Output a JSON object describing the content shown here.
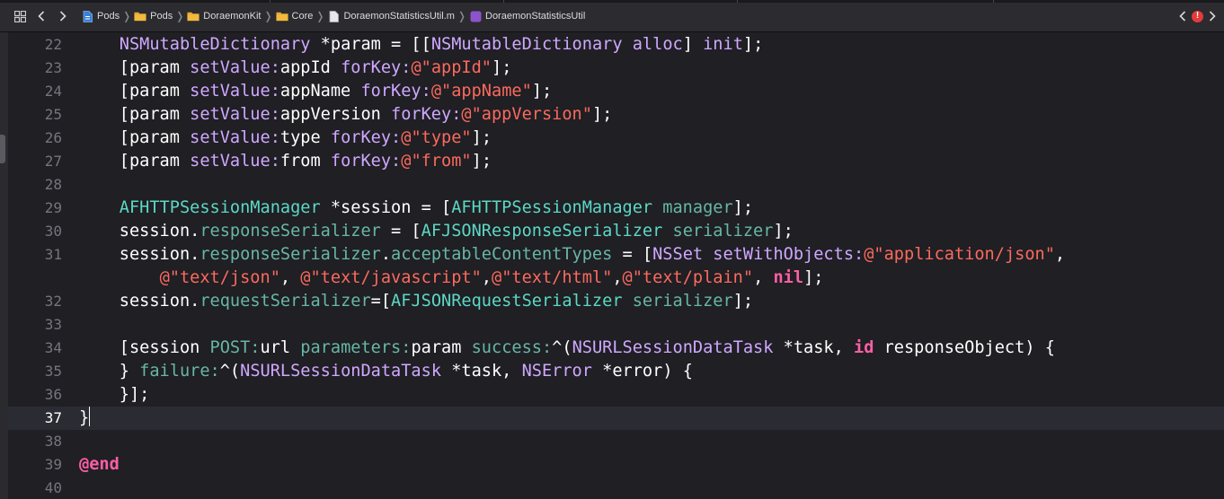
{
  "jumpbar": {
    "breadcrumbs": [
      {
        "label": "Pods",
        "icon": "project-file-icon"
      },
      {
        "label": "Pods",
        "icon": "folder-icon"
      },
      {
        "label": "DoraemonKit",
        "icon": "folder-icon"
      },
      {
        "label": "Core",
        "icon": "folder-icon"
      },
      {
        "label": "DoraemonStatisticsUtil.m",
        "icon": "objc-file-icon"
      },
      {
        "label": "DoraemonStatisticsUtil",
        "icon": "class-icon"
      }
    ],
    "class_icon_letter": "C",
    "file_icon_letter": "m",
    "issue_badge": "!",
    "back_glyph": "<",
    "forward_glyph": ">"
  },
  "editor": {
    "current_line": 37,
    "lines": [
      {
        "num": "22",
        "tokens": [
          {
            "t": "    "
          },
          {
            "t": "NSMutableDictionary",
            "c": "t-sys"
          },
          {
            "t": " *param = [["
          },
          {
            "t": "NSMutableDictionary",
            "c": "t-sys"
          },
          {
            "t": " "
          },
          {
            "t": "alloc",
            "c": "t-sys"
          },
          {
            "t": "] "
          },
          {
            "t": "init",
            "c": "t-sys"
          },
          {
            "t": "];"
          }
        ]
      },
      {
        "num": "23",
        "tokens": [
          {
            "t": "    [param "
          },
          {
            "t": "setValue:",
            "c": "t-sys"
          },
          {
            "t": "appId "
          },
          {
            "t": "forKey:",
            "c": "t-sys"
          },
          {
            "t": "@\"appId\"",
            "c": "t-str"
          },
          {
            "t": "];"
          }
        ]
      },
      {
        "num": "24",
        "tokens": [
          {
            "t": "    [param "
          },
          {
            "t": "setValue:",
            "c": "t-sys"
          },
          {
            "t": "appName "
          },
          {
            "t": "forKey:",
            "c": "t-sys"
          },
          {
            "t": "@\"appName\"",
            "c": "t-str"
          },
          {
            "t": "];"
          }
        ]
      },
      {
        "num": "25",
        "tokens": [
          {
            "t": "    [param "
          },
          {
            "t": "setValue:",
            "c": "t-sys"
          },
          {
            "t": "appVersion "
          },
          {
            "t": "forKey:",
            "c": "t-sys"
          },
          {
            "t": "@\"appVersion\"",
            "c": "t-str"
          },
          {
            "t": "];"
          }
        ]
      },
      {
        "num": "26",
        "tokens": [
          {
            "t": "    [param "
          },
          {
            "t": "setValue:",
            "c": "t-sys"
          },
          {
            "t": "type "
          },
          {
            "t": "forKey:",
            "c": "t-sys"
          },
          {
            "t": "@\"type\"",
            "c": "t-str"
          },
          {
            "t": "];"
          }
        ]
      },
      {
        "num": "27",
        "tokens": [
          {
            "t": "    [param "
          },
          {
            "t": "setValue:",
            "c": "t-sys"
          },
          {
            "t": "from "
          },
          {
            "t": "forKey:",
            "c": "t-sys"
          },
          {
            "t": "@\"from\"",
            "c": "t-str"
          },
          {
            "t": "];"
          }
        ]
      },
      {
        "num": "28",
        "tokens": []
      },
      {
        "num": "29",
        "tokens": [
          {
            "t": "    "
          },
          {
            "t": "AFHTTPSessionManager",
            "c": "t-cls"
          },
          {
            "t": " *session = ["
          },
          {
            "t": "AFHTTPSessionManager",
            "c": "t-cls"
          },
          {
            "t": " "
          },
          {
            "t": "manager",
            "c": "t-mth"
          },
          {
            "t": "];"
          }
        ]
      },
      {
        "num": "30",
        "tokens": [
          {
            "t": "    session."
          },
          {
            "t": "responseSerializer",
            "c": "t-mth"
          },
          {
            "t": " = ["
          },
          {
            "t": "AFJSONResponseSerializer",
            "c": "t-cls"
          },
          {
            "t": " "
          },
          {
            "t": "serializer",
            "c": "t-mth"
          },
          {
            "t": "];"
          }
        ]
      },
      {
        "num": "31",
        "tokens": [
          {
            "t": "    session."
          },
          {
            "t": "responseSerializer",
            "c": "t-mth"
          },
          {
            "t": "."
          },
          {
            "t": "acceptableContentTypes",
            "c": "t-mth"
          },
          {
            "t": " = ["
          },
          {
            "t": "NSSet",
            "c": "t-sys"
          },
          {
            "t": " "
          },
          {
            "t": "setWithObjects:",
            "c": "t-sys"
          },
          {
            "t": "@\"application/json\"",
            "c": "t-str"
          },
          {
            "t": ","
          }
        ]
      },
      {
        "num": "",
        "tokens": [
          {
            "t": "        "
          },
          {
            "t": "@\"text/json\"",
            "c": "t-str"
          },
          {
            "t": ", "
          },
          {
            "t": "@\"text/javascript\"",
            "c": "t-str"
          },
          {
            "t": ","
          },
          {
            "t": "@\"text/html\"",
            "c": "t-str"
          },
          {
            "t": ","
          },
          {
            "t": "@\"text/plain\"",
            "c": "t-str"
          },
          {
            "t": ", "
          },
          {
            "t": "nil",
            "c": "t-kw"
          },
          {
            "t": "];"
          }
        ]
      },
      {
        "num": "32",
        "tokens": [
          {
            "t": "    session."
          },
          {
            "t": "requestSerializer",
            "c": "t-mth"
          },
          {
            "t": "=["
          },
          {
            "t": "AFJSONRequestSerializer",
            "c": "t-cls"
          },
          {
            "t": " "
          },
          {
            "t": "serializer",
            "c": "t-mth"
          },
          {
            "t": "];"
          }
        ]
      },
      {
        "num": "33",
        "tokens": []
      },
      {
        "num": "34",
        "tokens": [
          {
            "t": "    [session "
          },
          {
            "t": "POST:",
            "c": "t-mth"
          },
          {
            "t": "url "
          },
          {
            "t": "parameters:",
            "c": "t-mth"
          },
          {
            "t": "param "
          },
          {
            "t": "success:",
            "c": "t-mth"
          },
          {
            "t": "^("
          },
          {
            "t": "NSURLSessionDataTask",
            "c": "t-sys"
          },
          {
            "t": " *task, "
          },
          {
            "t": "id",
            "c": "t-kw"
          },
          {
            "t": " responseObject) {"
          }
        ]
      },
      {
        "num": "35",
        "tokens": [
          {
            "t": "    } "
          },
          {
            "t": "failure:",
            "c": "t-mth"
          },
          {
            "t": "^("
          },
          {
            "t": "NSURLSessionDataTask",
            "c": "t-sys"
          },
          {
            "t": " *task, "
          },
          {
            "t": "NSError",
            "c": "t-sys"
          },
          {
            "t": " *error) {"
          }
        ]
      },
      {
        "num": "36",
        "tokens": [
          {
            "t": "    }];"
          }
        ]
      },
      {
        "num": "37",
        "current": true,
        "caret": true,
        "tokens": [
          {
            "t": "}"
          }
        ]
      },
      {
        "num": "38",
        "tokens": []
      },
      {
        "num": "39",
        "tokens": [
          {
            "t": "@end",
            "c": "t-kw"
          }
        ]
      },
      {
        "num": "40",
        "tokens": []
      }
    ]
  },
  "colors": {
    "background": "#1f1f24",
    "current_line": "#2b2c33",
    "class_name": "#5dd8c4",
    "method": "#67b7a4",
    "system": "#d0a8ff",
    "string": "#fc6a5d",
    "keyword": "#fc5fa3",
    "line_number": "#75757c"
  }
}
